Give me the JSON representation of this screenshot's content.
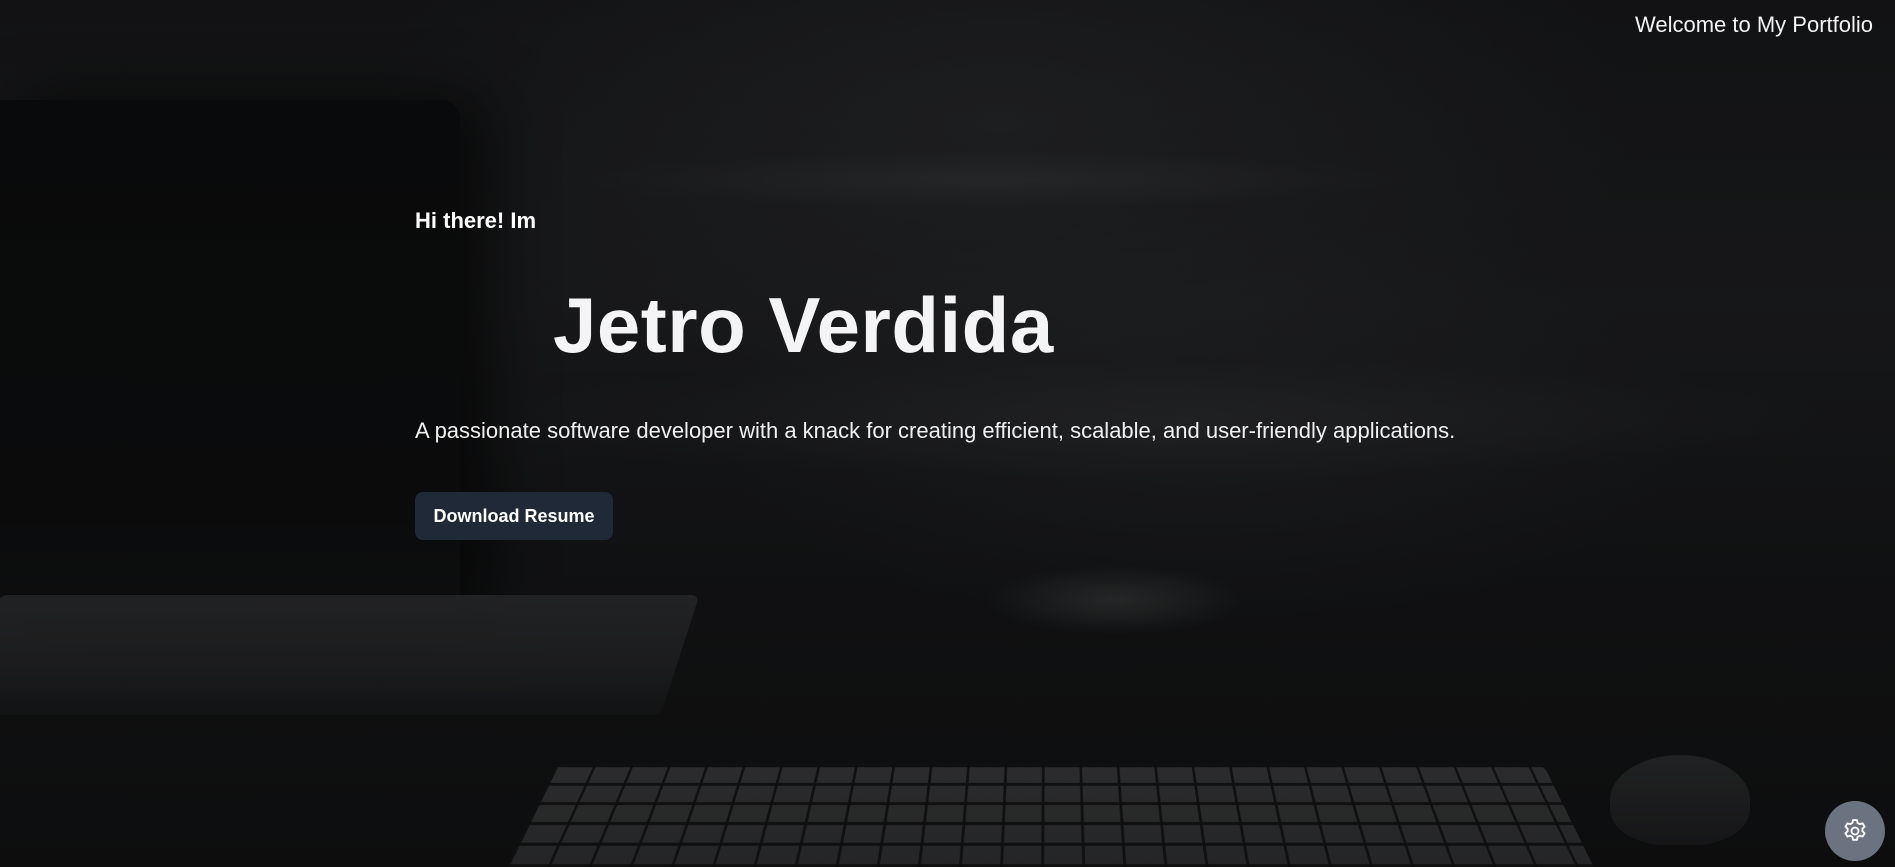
{
  "header": {
    "title": "Welcome to My Portfolio"
  },
  "hero": {
    "greeting": "Hi there! Im",
    "name": "Jetro Verdida",
    "tagline": "A passionate software developer with a knack for creating efficient, scalable, and user-friendly applications.",
    "resume_button_label": "Download Resume"
  },
  "settings_fab": {
    "icon": "gear-icon"
  },
  "colors": {
    "button_bg": "#1f2937",
    "fab_bg": "#6b7280",
    "text": "#ffffff"
  }
}
